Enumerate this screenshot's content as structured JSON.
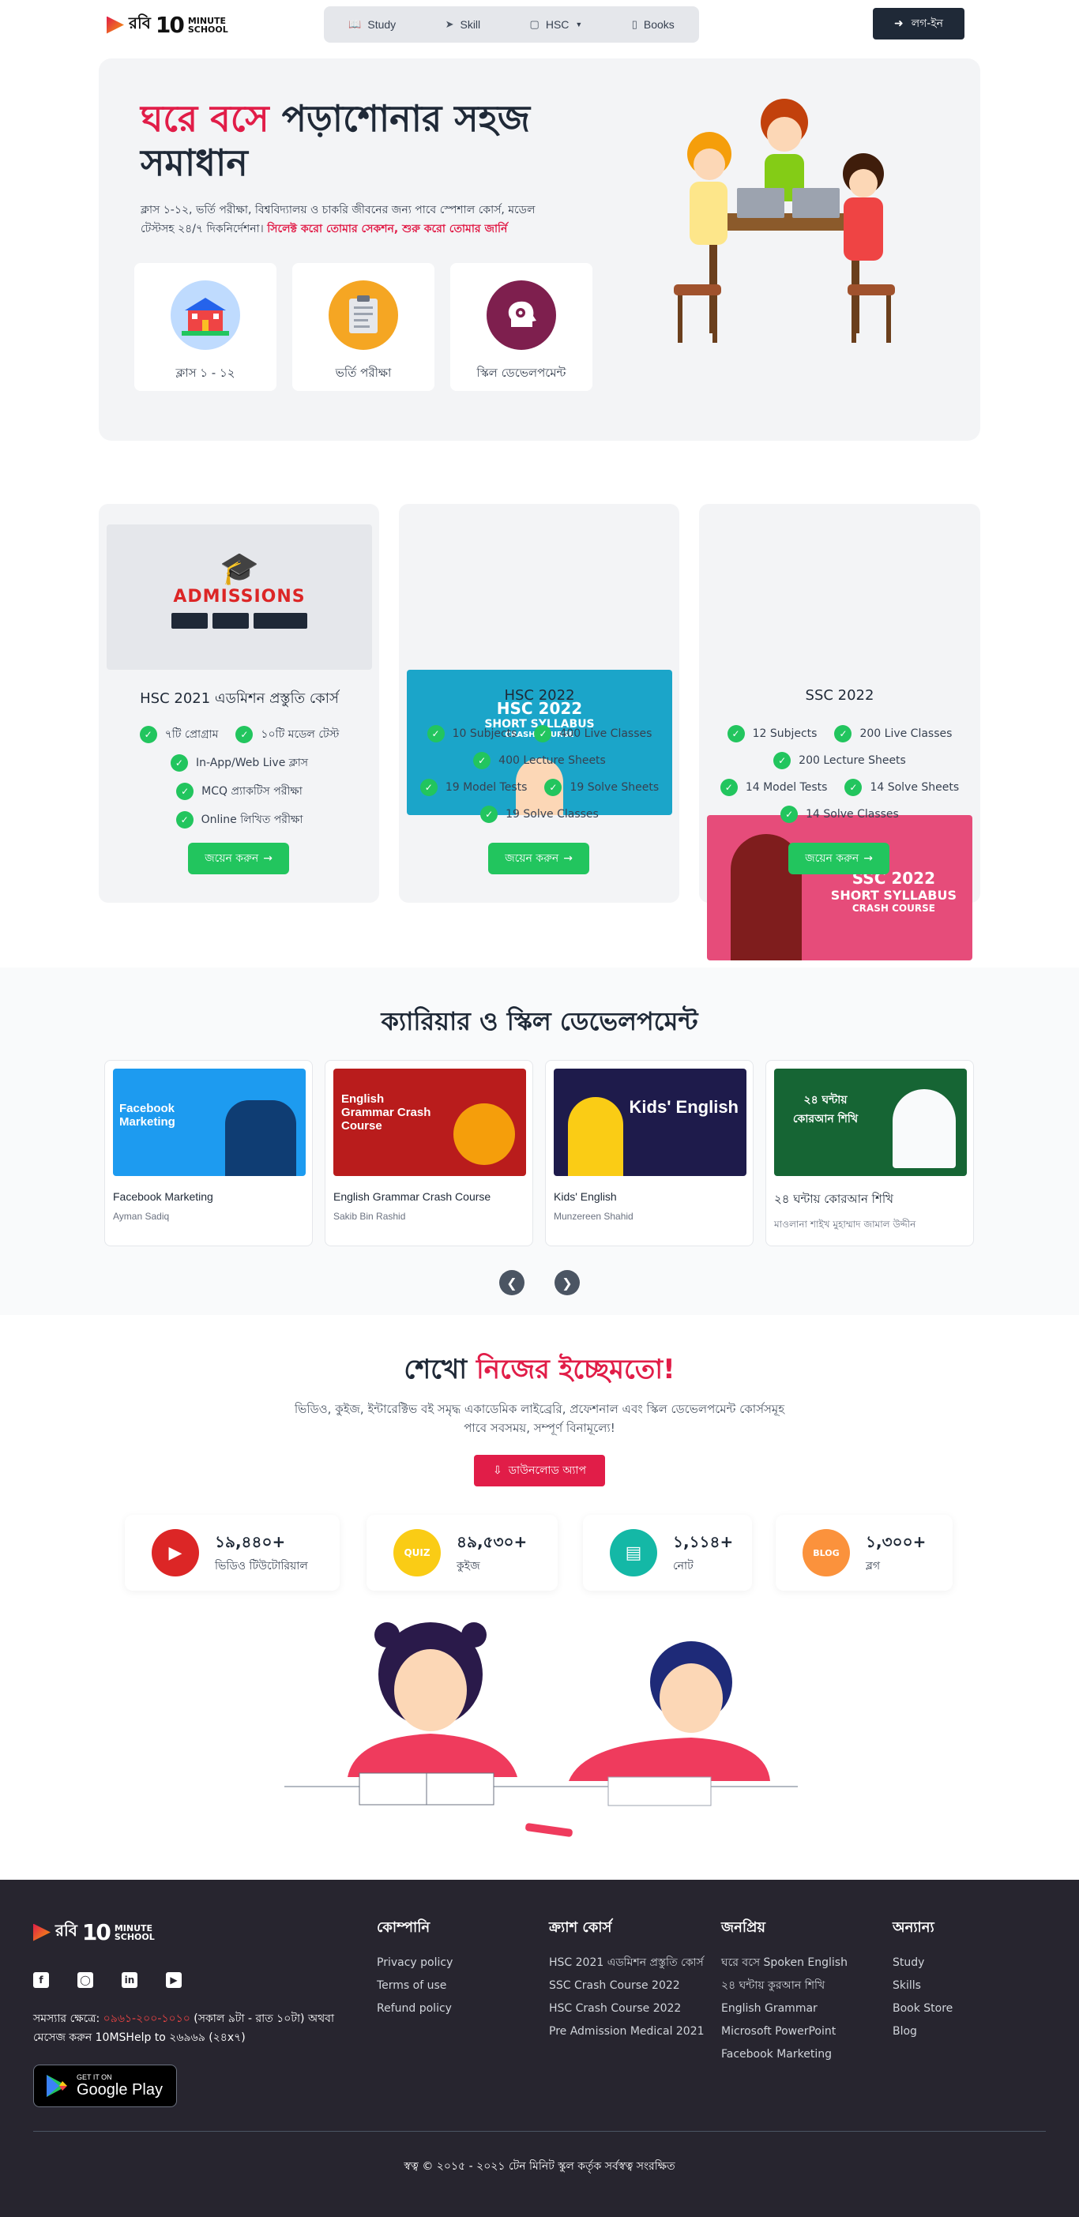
{
  "header": {
    "logo": {
      "bangla": "রবি",
      "ten": "10",
      "minute": "MINUTE",
      "school": "SCHOOL"
    },
    "nav": [
      {
        "label": "Study",
        "icon": "book-open-icon"
      },
      {
        "label": "Skill",
        "icon": "rocket-icon"
      },
      {
        "label": "HSC",
        "icon": "video-icon"
      },
      {
        "label": "Books",
        "icon": "tablet-icon"
      }
    ],
    "login_label": "লগ-ইন"
  },
  "hero": {
    "title_accent": "ঘরে বসে",
    "title_rest_1": "পড়াশোনার সহজ",
    "title_rest_2": "সমাধান",
    "desc_1": "ক্লাস ১-১২, ভর্তি পরীক্ষা, বিশ্ববিদ্যালয় ও চাকরি জীবনের জন্য পাবে স্পেশাল কোর্স, মডেল",
    "desc_2": "টেস্টসহ ২৪/৭ দিকনির্দেশনা।",
    "desc_accent": "সিলেক্ট করো তোমার সেকশন, শুরু করো তোমার জার্নি",
    "cards": [
      {
        "label": "ক্লাস ১ - ১২",
        "icon": "school-building-icon",
        "color": "#60a5fa"
      },
      {
        "label": "ভর্তি পরীক্ষা",
        "icon": "exam-clipboard-icon",
        "color": "#f59e0b"
      },
      {
        "label": "স্কিল ডেভেলপমেন্ট",
        "icon": "brain-gear-icon",
        "color": "#7e1f4e"
      }
    ]
  },
  "courses": [
    {
      "title": "HSC 2021 এডমিশন প্রস্তুতি কোর্স",
      "banner_line1": "ADMISSIONS",
      "banner_line2": "",
      "banner_line3": "",
      "features": [
        [
          "৭টি প্রোগ্রাম",
          "১০টি মডেল টেস্ট"
        ],
        [
          "In-App/Web Live ক্লাস"
        ],
        [
          "MCQ প্র্যাকটিস পরীক্ষা"
        ],
        [
          "Online লিখিত পরীক্ষা"
        ]
      ],
      "join": "জয়েন করুন"
    },
    {
      "title": "HSC 2022",
      "banner_line1": "HSC 2022",
      "banner_line2": "SHORT SYLLABUS",
      "banner_line3": "CRASH COURSE",
      "features": [
        [
          "10 Subjects",
          "400 Live Classes"
        ],
        [
          "400 Lecture Sheets"
        ],
        [
          "19 Model Tests",
          "19 Solve Sheets"
        ],
        [
          "19 Solve Classes"
        ]
      ],
      "join": "জয়েন করুন"
    },
    {
      "title": "SSC 2022",
      "banner_line1": "SSC 2022",
      "banner_line2": "SHORT SYLLABUS",
      "banner_line3": "CRASH COURSE",
      "features": [
        [
          "12 Subjects",
          "200 Live Classes"
        ],
        [
          "200 Lecture Sheets"
        ],
        [
          "14 Model Tests",
          "14 Solve Sheets"
        ],
        [
          "14 Solve Classes"
        ]
      ],
      "join": "জয়েন করুন"
    }
  ],
  "skills": {
    "title": "ক্যারিয়ার ও স্কিল ডেভেলপমেন্ট",
    "items": [
      {
        "title": "Facebook Marketing",
        "author": "Ayman Sadiq",
        "banner": "Facebook Marketing",
        "bg": "#1d9bf0"
      },
      {
        "title": "English Grammar Crash Course",
        "author": "Sakib Bin Rashid",
        "banner": "English Grammar Crash Course",
        "bg": "#b91c1c"
      },
      {
        "title": "Kids' English",
        "author": "Munzereen Shahid",
        "banner": "Kids' English",
        "bg": "#1e1b4b"
      },
      {
        "title": "২৪ ঘন্টায় কোরআন শিখি",
        "author": "মাওলানা শাইখ মুহাম্মাদ জামাল উদ্দীন",
        "banner": "২৪ ঘন্টায় কোরআন শিখি",
        "bg": "#166534"
      }
    ]
  },
  "learn": {
    "title_plain": "শেখো",
    "title_accent": "নিজের ইচ্ছেমতো!",
    "desc_1": "ভিডিও, কুইজ, ইন্টারেক্টিভ বই সমৃদ্ধ একাডেমিক লাইব্রেরি, প্রফেশনাল এবং স্কিল ডেভেলপমেন্ট কোর্সসমূহ",
    "desc_2": "পাবে সবসময়, সম্পূর্ণ বিনামূল্যে!",
    "download_label": "ডাউনলোড অ্যাপ",
    "stats": [
      {
        "num": "১৯,৪৪০+",
        "label": "ভিডিও টিউটোরিয়াল",
        "icon": "play-icon",
        "color": "#dc2626"
      },
      {
        "num": "৪৯,৫৩০+",
        "label": "কুইজ",
        "icon": "quiz-stopwatch-icon",
        "color": "#facc15"
      },
      {
        "num": "১,১১৪+",
        "label": "নোট",
        "icon": "note-icon",
        "color": "#14b8a6"
      },
      {
        "num": "১,৩০০+",
        "label": "ব্লগ",
        "icon": "blog-icon",
        "color": "#fb923c"
      }
    ]
  },
  "footer": {
    "help_prefix": "সমস্যার ক্ষেত্রে:",
    "help_phone": "০৯৬১-২০০-১০১০",
    "help_suffix": "(সকাল ৯টা - রাত ১০টা) অথবা",
    "help_line2": "মেসেজ করুন 10MSHelp to ২৬৯৬৯ (২৪x৭)",
    "gp_small": "GET IT ON",
    "gp_big": "Google Play",
    "columns": [
      {
        "heading": "কোম্পানি",
        "links": [
          "Privacy policy",
          "Terms of use",
          "Refund policy"
        ]
      },
      {
        "heading": "ক্র্যাশ কোর্স",
        "links": [
          "HSC 2021 এডমিশন প্রস্তুতি কোর্স",
          "SSC Crash Course 2022",
          "HSC Crash Course 2022",
          "Pre Admission Medical 2021"
        ]
      },
      {
        "heading": "জনপ্রিয়",
        "links": [
          "ঘরে বসে Spoken English",
          "২৪ ঘন্টায় কুরআন শিখি",
          "English Grammar",
          "Microsoft PowerPoint",
          "Facebook Marketing"
        ]
      },
      {
        "heading": "অন্যান্য",
        "links": [
          "Study",
          "Skills",
          "Book Store",
          "Blog"
        ]
      }
    ],
    "copyright": "স্বত্ব © ২০১৫ - ২০২১ টেন মিনিট স্কুল কর্তৃক সর্বস্বত্ব সংরক্ষিত"
  },
  "colors": {
    "accent": "#e11d48",
    "green": "#22c55e",
    "footer_bg": "#27252f"
  }
}
